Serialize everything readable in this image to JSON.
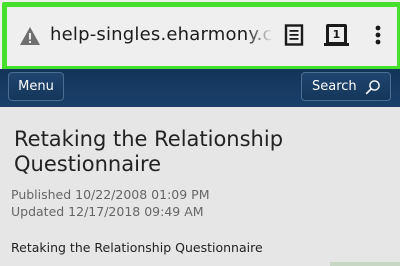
{
  "browser": {
    "url_text": "help-singles.eharmony.com/",
    "icons": {
      "security": "warning-triangle-icon",
      "reader": "reader-mode-icon",
      "tabs": "tab-switcher-icon",
      "menu": "overflow-menu-icon"
    },
    "tab_count": "1",
    "highlight_color": "#44e02c"
  },
  "site_header": {
    "menu_label": "Menu",
    "search_label": "Search",
    "search_icon": "search-icon",
    "background_color": "#13345a"
  },
  "article": {
    "title": "Retaking the Relationship Questionnaire",
    "published": "Published 10/22/2008 01:09 PM",
    "updated": "Updated 12/17/2018 09:49 AM",
    "subtitle": "Retaking the Relationship Questionnaire"
  }
}
